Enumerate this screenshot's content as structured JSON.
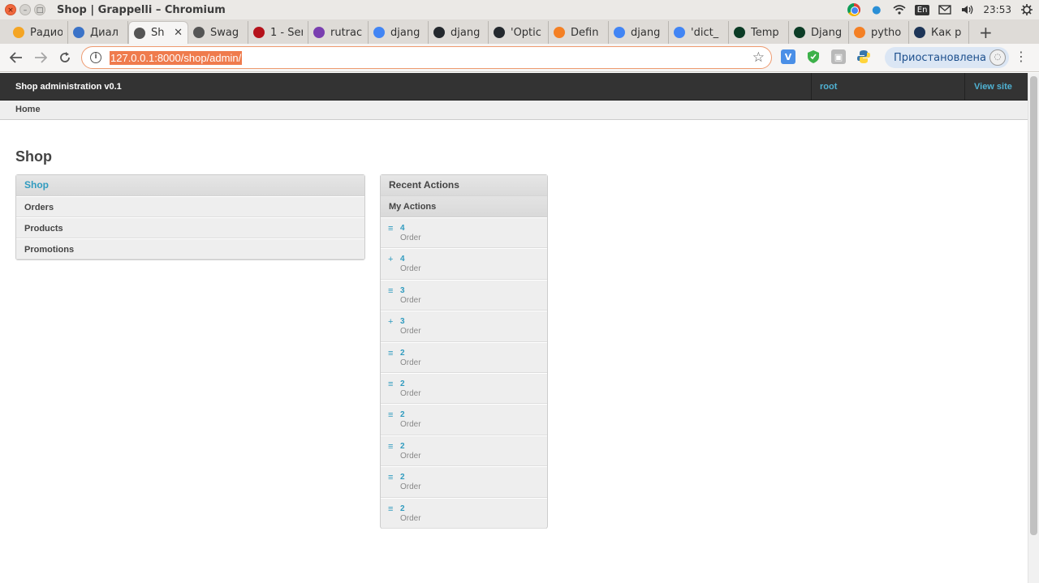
{
  "os": {
    "window_title": "Shop | Grappelli – Chromium",
    "keyboard_layout": "En",
    "clock": "23:53"
  },
  "tabs": [
    {
      "label": "Радио",
      "color": "#f4a524"
    },
    {
      "label": "Диал",
      "color": "#3b73c8"
    },
    {
      "label": "Sh",
      "color": "#555555",
      "active": true
    },
    {
      "label": "Swag",
      "color": "#555555"
    },
    {
      "label": "1 - Ser",
      "color": "#b5121b"
    },
    {
      "label": "rutrac",
      "color": "#7a3fb0"
    },
    {
      "label": "djang",
      "color": "#4285f4"
    },
    {
      "label": "djang",
      "color": "#24292e"
    },
    {
      "label": "'Optic",
      "color": "#24292e"
    },
    {
      "label": "Defin",
      "color": "#f48024"
    },
    {
      "label": "djang",
      "color": "#4285f4"
    },
    {
      "label": "'dict_",
      "color": "#4285f4"
    },
    {
      "label": "Temp",
      "color": "#0c3c26"
    },
    {
      "label": "Djang",
      "color": "#0c3c26"
    },
    {
      "label": "pytho",
      "color": "#f48024"
    },
    {
      "label": "Как р",
      "color": "#1d3557"
    }
  ],
  "address_bar": {
    "url": "127.0.0.1:8000/shop/admin/"
  },
  "profile": {
    "label": "Приостановлена"
  },
  "admin": {
    "brand": "Shop administration v0.1",
    "user": "root",
    "view_site": "View site",
    "breadcrumb": "Home",
    "page_title": "Shop"
  },
  "app_module": {
    "title": "Shop",
    "models": [
      "Orders",
      "Products",
      "Promotions"
    ]
  },
  "recent_actions": {
    "title": "Recent Actions",
    "subtitle": "My Actions",
    "items": [
      {
        "icon": "change",
        "name": "4",
        "type": "Order"
      },
      {
        "icon": "add",
        "name": "4",
        "type": "Order"
      },
      {
        "icon": "change",
        "name": "3",
        "type": "Order"
      },
      {
        "icon": "add",
        "name": "3",
        "type": "Order"
      },
      {
        "icon": "change",
        "name": "2",
        "type": "Order"
      },
      {
        "icon": "change",
        "name": "2",
        "type": "Order"
      },
      {
        "icon": "change",
        "name": "2",
        "type": "Order"
      },
      {
        "icon": "change",
        "name": "2",
        "type": "Order"
      },
      {
        "icon": "change",
        "name": "2",
        "type": "Order"
      },
      {
        "icon": "change",
        "name": "2",
        "type": "Order"
      }
    ]
  }
}
